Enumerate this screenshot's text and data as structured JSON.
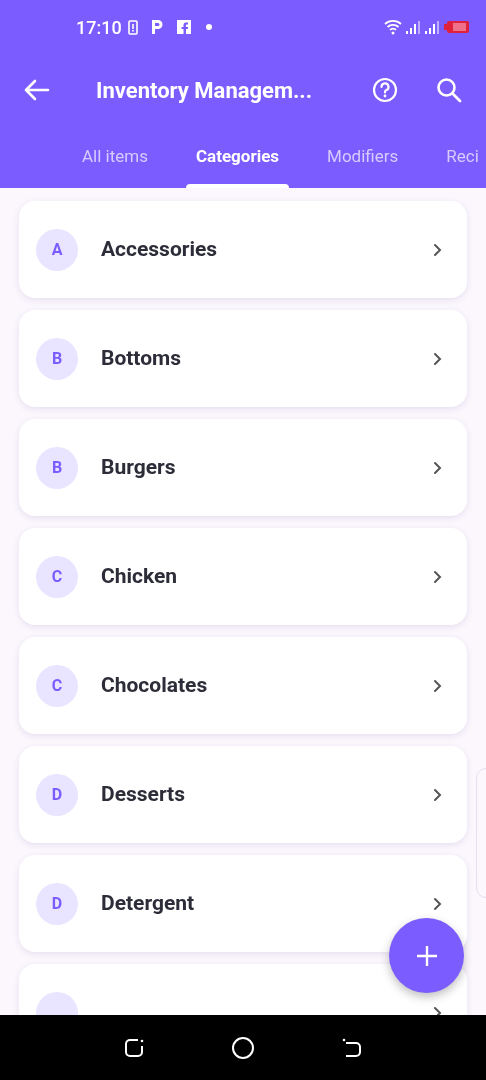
{
  "status_bar": {
    "time": "17:10"
  },
  "app_bar": {
    "title": "Inventory Managem..."
  },
  "tabs": [
    {
      "label": "All items",
      "selected": false
    },
    {
      "label": "Categories",
      "selected": true
    },
    {
      "label": "Modifiers",
      "selected": false
    },
    {
      "label": "Reci",
      "selected": false
    }
  ],
  "categories": [
    {
      "initial": "A",
      "name": "Accessories"
    },
    {
      "initial": "B",
      "name": "Bottoms"
    },
    {
      "initial": "B",
      "name": "Burgers"
    },
    {
      "initial": "C",
      "name": "Chicken"
    },
    {
      "initial": "C",
      "name": "Chocolates"
    },
    {
      "initial": "D",
      "name": "Desserts"
    },
    {
      "initial": "D",
      "name": "Detergent"
    }
  ]
}
